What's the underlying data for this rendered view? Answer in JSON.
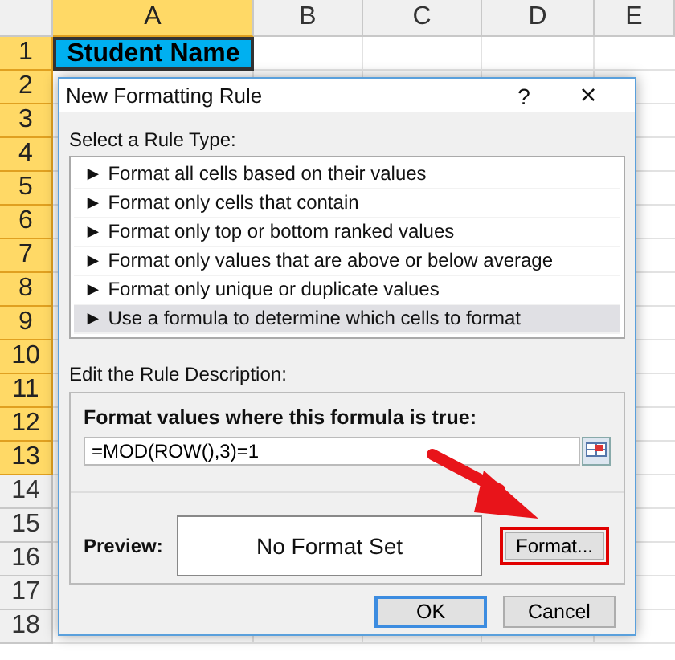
{
  "spreadsheet": {
    "columns": [
      {
        "label": "A",
        "selected": true
      },
      {
        "label": "B",
        "selected": false
      },
      {
        "label": "C",
        "selected": false
      },
      {
        "label": "D",
        "selected": false
      },
      {
        "label": "E",
        "selected": false
      }
    ],
    "rows": [
      {
        "label": "1",
        "selected": true
      },
      {
        "label": "2",
        "selected": true
      },
      {
        "label": "3",
        "selected": true
      },
      {
        "label": "4",
        "selected": true
      },
      {
        "label": "5",
        "selected": true
      },
      {
        "label": "6",
        "selected": true
      },
      {
        "label": "7",
        "selected": true
      },
      {
        "label": "8",
        "selected": true
      },
      {
        "label": "9",
        "selected": true
      },
      {
        "label": "10",
        "selected": true
      },
      {
        "label": "11",
        "selected": true
      },
      {
        "label": "12",
        "selected": true
      },
      {
        "label": "13",
        "selected": true
      },
      {
        "label": "14",
        "selected": false
      },
      {
        "label": "15",
        "selected": false
      },
      {
        "label": "16",
        "selected": false
      },
      {
        "label": "17",
        "selected": false
      },
      {
        "label": "18",
        "selected": false
      }
    ],
    "header_cell": "Student Name"
  },
  "dialog": {
    "title": "New Formatting Rule",
    "help": "?",
    "close": "×",
    "rule_type_label": "Select a Rule Type:",
    "rule_types": [
      {
        "label": "► Format all cells based on their values",
        "selected": false
      },
      {
        "label": "► Format only cells that contain",
        "selected": false
      },
      {
        "label": "► Format only top or bottom ranked values",
        "selected": false
      },
      {
        "label": "► Format only values that are above or below average",
        "selected": false
      },
      {
        "label": "► Format only unique or duplicate values",
        "selected": false
      },
      {
        "label": "► Use a formula to determine which cells to format",
        "selected": true
      }
    ],
    "description_label": "Edit the Rule Description:",
    "formula_label": "Format values where this formula is true:",
    "formula": "=MOD(ROW(),3)=1",
    "preview_label": "Preview:",
    "preview_text": "No Format Set",
    "format_button": {
      "label": "Format...",
      "highlighted": true
    },
    "buttons": [
      "OK",
      "Cancel"
    ]
  }
}
